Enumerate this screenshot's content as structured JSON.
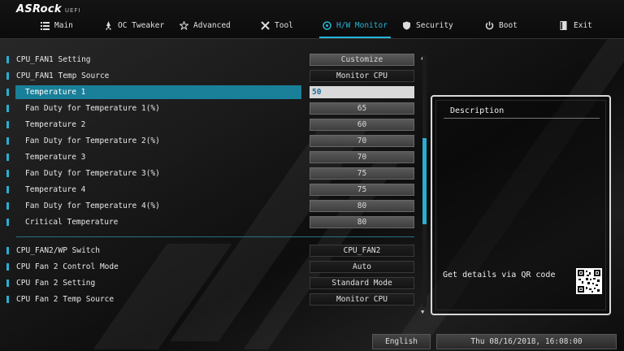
{
  "header": {
    "logo": "ASRock",
    "logo_sub": "UEFI",
    "tabs": [
      {
        "label": "Main",
        "icon": "list-icon"
      },
      {
        "label": "OC Tweaker",
        "icon": "rocket-icon"
      },
      {
        "label": "Advanced",
        "icon": "star-icon"
      },
      {
        "label": "Tool",
        "icon": "tools-icon"
      },
      {
        "label": "H/W Monitor",
        "icon": "monitor-icon"
      },
      {
        "label": "Security",
        "icon": "shield-icon"
      },
      {
        "label": "Boot",
        "icon": "power-icon"
      },
      {
        "label": "Exit",
        "icon": "exit-icon"
      }
    ],
    "active_tab": "H/W Monitor"
  },
  "fan1": {
    "setting": {
      "label": "CPU_FAN1 Setting",
      "value": "Customize"
    },
    "temp_source": {
      "label": "CPU_FAN1 Temp Source",
      "value": "Monitor CPU"
    },
    "points": [
      {
        "label": "Temperature 1",
        "value": "50"
      },
      {
        "label": "Fan Duty for Temperature 1(%)",
        "value": "65"
      },
      {
        "label": "Temperature 2",
        "value": "60"
      },
      {
        "label": "Fan Duty for Temperature 2(%)",
        "value": "70"
      },
      {
        "label": "Temperature 3",
        "value": "70"
      },
      {
        "label": "Fan Duty for Temperature 3(%)",
        "value": "75"
      },
      {
        "label": "Temperature 4",
        "value": "75"
      },
      {
        "label": "Fan Duty for Temperature 4(%)",
        "value": "80"
      },
      {
        "label": "Critical Temperature",
        "value": "80"
      }
    ]
  },
  "fan2": {
    "switch": {
      "label": "CPU_FAN2/WP Switch",
      "value": "CPU_FAN2"
    },
    "control_mode": {
      "label": "CPU Fan 2 Control Mode",
      "value": "Auto"
    },
    "setting": {
      "label": "CPU Fan 2 Setting",
      "value": "Standard Mode"
    },
    "temp_source": {
      "label": "CPU Fan 2 Temp Source",
      "value": "Monitor CPU"
    }
  },
  "description": {
    "title": "Description",
    "qr_text": "Get details via QR code"
  },
  "footer": {
    "language": "English",
    "datetime": "Thu 08/16/2018, 16:08:00"
  },
  "colors": {
    "accent": "#27b6d6",
    "selection": "#1a7f99"
  }
}
